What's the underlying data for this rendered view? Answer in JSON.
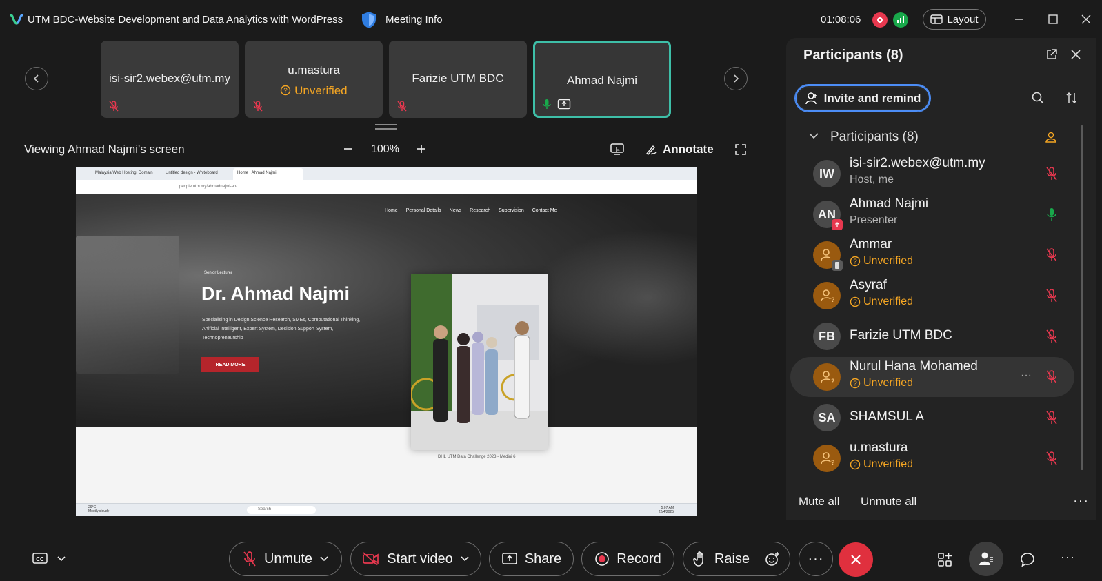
{
  "titlebar": {
    "title": "UTM BDC-Website Development and Data Analytics with WordPress",
    "meeting_info": "Meeting Info",
    "timer": "01:08:06",
    "layout_label": "Layout"
  },
  "thumbnails": [
    {
      "name": "isi-sir2.webex@utm.my",
      "status": ""
    },
    {
      "name": "u.mastura",
      "status": "Unverified"
    },
    {
      "name": "Farizie UTM BDC",
      "status": ""
    },
    {
      "name": "Ahmad Najmi",
      "status": ""
    }
  ],
  "sharebar": {
    "viewing": "Viewing Ahmad Najmi's screen",
    "zoom": "100%",
    "annotate": "Annotate"
  },
  "shared_screen": {
    "tabs": [
      "Malaysia Web Hosting, Domain",
      "Untitled design - Whiteboard",
      "Home | Ahmad Najmi"
    ],
    "url": "people.utm.my/ahmadnajmi-an/",
    "nav": [
      "Home",
      "Personal Details",
      "News",
      "Research",
      "Supervision",
      "Contact Me"
    ],
    "role": "Senior Lecturer",
    "name": "Dr. Ahmad Najmi",
    "description": "Specialising in Design Science Research, SMEs, Computational Thinking, Artificial Intelligent, Expert System, Decision Support System, Technopreneurship",
    "read_more": "READ MORE",
    "caption": "DHL UTM Data Challenge 2023 - Medini 6",
    "taskbar_search": "Search",
    "weather": "29°C",
    "weather_desc": "Mostly cloudy",
    "clock_time": "5:07 AM",
    "clock_date": "22/4/2025"
  },
  "panel": {
    "title": "Participants (8)",
    "invite": "Invite and remind",
    "group_label": "Participants (8)",
    "participants": [
      {
        "name": "isi-sir2.webex@utm.my",
        "sub": "Host, me",
        "initials": "IW"
      },
      {
        "name": "Ahmad Najmi",
        "sub": "Presenter",
        "initials": "AN"
      },
      {
        "name": "Ammar",
        "sub": "Unverified",
        "initials": ""
      },
      {
        "name": "Asyraf",
        "sub": "Unverified",
        "initials": ""
      },
      {
        "name": "Farizie UTM BDC",
        "sub": "",
        "initials": "FB"
      },
      {
        "name": "Nurul Hana Mohamed",
        "sub": "Unverified",
        "initials": ""
      },
      {
        "name": "SHAMSUL A",
        "sub": "",
        "initials": "SA"
      },
      {
        "name": "u.mastura",
        "sub": "Unverified",
        "initials": ""
      }
    ],
    "mute_all": "Mute all",
    "unmute_all": "Unmute all"
  },
  "controls": {
    "unmute": "Unmute",
    "start_video": "Start video",
    "share": "Share",
    "record": "Record",
    "raise": "Raise"
  },
  "colors": {
    "accent_blue": "#4c8df6",
    "active_border": "#3ebfa8",
    "unverified": "#f5a623",
    "muted_red": "#e8384f",
    "leave_red": "#e0303e",
    "mic_green": "#19a84b"
  },
  "icons": [
    "webex-logo-icon",
    "shield-icon",
    "record-indicator-icon",
    "signal-icon",
    "layout-icon",
    "mic-muted-icon",
    "mic-on-icon",
    "share-screen-icon",
    "zoom-in-icon",
    "zoom-out-icon",
    "annotate-icon",
    "fullscreen-icon",
    "search-icon",
    "sort-icon",
    "popout-icon",
    "close-icon",
    "cc-icon",
    "video-off-icon",
    "record-icon",
    "raise-hand-icon",
    "reactions-icon",
    "leave-icon",
    "apps-icon",
    "participants-icon",
    "chat-icon"
  ]
}
